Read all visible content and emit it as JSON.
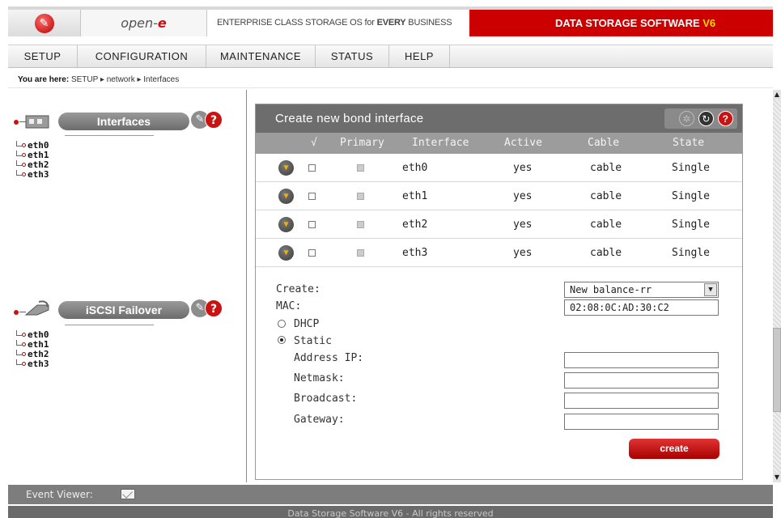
{
  "header": {
    "brand_prefix": "open-",
    "brand_suffix": "e",
    "tagline_a": "ENTERPRISE CLASS STORAGE OS for ",
    "tagline_b": "EVERY",
    "tagline_c": " BUSINESS",
    "product": "DATA STORAGE SOFTWARE ",
    "version": "V6"
  },
  "menu": [
    "SETUP",
    "CONFIGURATION",
    "MAINTENANCE",
    "STATUS",
    "HELP"
  ],
  "breadcrumb": {
    "label": "You are here:",
    "path": "SETUP ▸ network ▸ Interfaces"
  },
  "left_panels": [
    {
      "title": "Interfaces",
      "items": [
        "eth0",
        "eth1",
        "eth2",
        "eth3"
      ]
    },
    {
      "title": "iSCSI Failover",
      "items": [
        "eth0",
        "eth1",
        "eth2",
        "eth3"
      ]
    }
  ],
  "main": {
    "title": "Create new bond interface",
    "columns": [
      "√",
      "Primary",
      "Interface",
      "Active",
      "Cable",
      "State"
    ],
    "rows": [
      {
        "interface": "eth0",
        "active": "yes",
        "cable": "cable",
        "state": "Single"
      },
      {
        "interface": "eth1",
        "active": "yes",
        "cable": "cable",
        "state": "Single"
      },
      {
        "interface": "eth2",
        "active": "yes",
        "cable": "cable",
        "state": "Single"
      },
      {
        "interface": "eth3",
        "active": "yes",
        "cable": "cable",
        "state": "Single"
      }
    ],
    "form": {
      "create_label": "Create:",
      "create_value": "New balance-rr",
      "mac_label": "MAC:",
      "mac_value": "02:08:0C:AD:30:C2",
      "dhcp_label": "DHCP",
      "static_label": "Static",
      "address_label": "Address IP:",
      "netmask_label": "Netmask:",
      "broadcast_label": "Broadcast:",
      "gateway_label": "Gateway:",
      "address_value": "",
      "netmask_value": "",
      "broadcast_value": "",
      "gateway_value": "",
      "selected_mode": "Static",
      "button": "create"
    }
  },
  "event_viewer": "Event Viewer:",
  "footer": "Data Storage Software V6 - All rights reserved",
  "colors": {
    "accent": "#cc0000",
    "version": "#ffd700",
    "panel": "#6d6d6d",
    "header_row": "#9c9c9c"
  }
}
